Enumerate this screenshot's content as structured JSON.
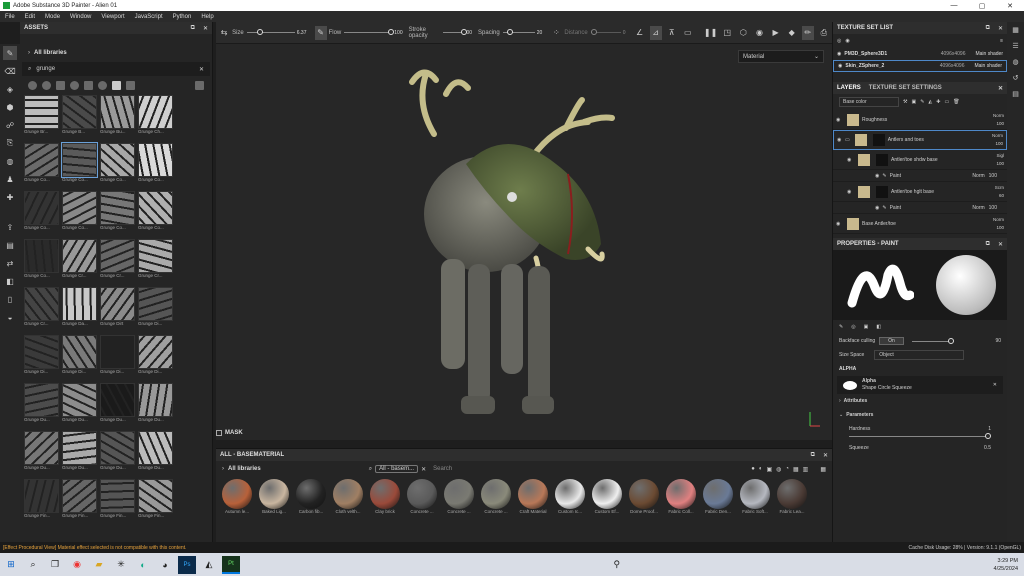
{
  "window": {
    "title": "Adobe Substance 3D Painter - Alien 01"
  },
  "menu": [
    "File",
    "Edit",
    "Mode",
    "Window",
    "Viewport",
    "JavaScript",
    "Python",
    "Help"
  ],
  "toolbar": {
    "size_label": "Size",
    "size_value": "6.37",
    "flow_label": "Flow",
    "flow_value": "100",
    "stroke_label": "Stroke opacity",
    "stroke_value": "100",
    "spacing_label": "Spacing",
    "spacing_value": "20",
    "distance_label": "Distance",
    "distance_value": "0"
  },
  "assets": {
    "title": "ASSETS",
    "library": "All libraries",
    "search": "grunge",
    "thumbs": [
      "Grunge Br...",
      "Grunge B...",
      "Grunge Bu...",
      "Grunge Ch...",
      "Grunge Co...",
      "Grunge Co...",
      "Grunge Co...",
      "Grunge Co...",
      "Grunge Co...",
      "Grunge Co...",
      "Grunge Co...",
      "Grunge Co...",
      "Grunge Co...",
      "Grunge Cr...",
      "Grunge Cr...",
      "Grunge Cr...",
      "Grunge Cr...",
      "Grunge Da...",
      "Grunge Dirt",
      "Grunge Di...",
      "Grunge Di...",
      "Grunge Di...",
      "Grunge Di...",
      "Grunge Di...",
      "Grunge Du...",
      "Grunge Du...",
      "Grunge Du...",
      "Grunge Du...",
      "Grunge Du...",
      "Grunge Du...",
      "Grunge Du...",
      "Grunge Du...",
      "Grunge Fin...",
      "Grunge Fin...",
      "Grunge Fin...",
      "Grunge Fin..."
    ]
  },
  "viewport": {
    "mode": "Material",
    "mask_label": "MASK"
  },
  "shelf": {
    "title": "ALL - BASEMATERIAL",
    "library": "All libraries",
    "tag": "All - basem...",
    "search_placeholder": "Search",
    "materials": [
      {
        "name": "Autumn le...",
        "color": "#b8613a"
      },
      {
        "name": "Baked Lig...",
        "color": "#c9b6a0"
      },
      {
        "name": "Carbon fib...",
        "color": "#222222"
      },
      {
        "name": "Cloth velth...",
        "color": "#a07f63"
      },
      {
        "name": "Clay brick",
        "color": "#9a4a3a"
      },
      {
        "name": "Concrete ...",
        "color": "#5a5a5a"
      },
      {
        "name": "Concrete ...",
        "color": "#7a7a72"
      },
      {
        "name": "Concrete ...",
        "color": "#8a8a7a"
      },
      {
        "name": "Craft Material",
        "color": "#b87858"
      },
      {
        "name": "Custom Ic...",
        "color": "#e8e8e8"
      },
      {
        "name": "Custom Ef...",
        "color": "#efefef"
      },
      {
        "name": "Dome Proof...",
        "color": "#6b4a32"
      },
      {
        "name": "Fabric Coll...",
        "color": "#e08080"
      },
      {
        "name": "Fabric Den...",
        "color": "#6a7a96"
      },
      {
        "name": "Fabric Soft...",
        "color": "#b5b8c0"
      },
      {
        "name": "Fabric Lea...",
        "color": "#4a3a34"
      }
    ]
  },
  "textureset": {
    "title": "TEXTURE SET LIST",
    "rows": [
      {
        "name": "PM3D_Sphere3D1",
        "res": "4096x4096",
        "shader": "Main shader"
      },
      {
        "name": "Skin_ZSphere_2",
        "res": "4096x4096",
        "shader": "Main shader"
      }
    ]
  },
  "layers": {
    "tab1": "LAYERS",
    "tab2": "TEXTURE SET SETTINGS",
    "channel": "Base color",
    "items": [
      {
        "name": "Roughness",
        "blend": "Norm",
        "opacity": "100"
      },
      {
        "name": "Antlers and toes",
        "blend": "Norm",
        "opacity": "100"
      },
      {
        "name": "Antler/toe shdw base",
        "blend": "Sigl",
        "opacity": "100"
      },
      {
        "name": "Antler/toe hglt base",
        "blend": "Scrn",
        "opacity": "60"
      },
      {
        "name": "Base Antler/toe",
        "blend": "Norm",
        "opacity": "100"
      }
    ],
    "paint_label": "Paint",
    "paint_blend": "Norm",
    "paint_opacity": "100"
  },
  "properties": {
    "title": "PROPERTIES - PAINT",
    "backface_label": "Backface culling",
    "backface_value": "On",
    "backface_num": "90",
    "sizespace_label": "Size Space",
    "sizespace_value": "Object",
    "alpha_section": "ALPHA",
    "alpha_name": "Alpha",
    "alpha_sub": "Shape Circle Squeeze",
    "attributes": "Attributes",
    "parameters": "Parameters",
    "hardness_label": "Hardness",
    "hardness_value": "1",
    "squeeze_label": "Squeeze",
    "squeeze_value": "0.5"
  },
  "status": {
    "warning": "[Effect Procedural View] Material effect selected is not compatible with this content.",
    "right": "Cache Disk Usage:  28% | Version: 9.1.1 (OpenGL)"
  },
  "taskbar": {
    "time": "3:29 PM",
    "date": "4/25/2024"
  }
}
